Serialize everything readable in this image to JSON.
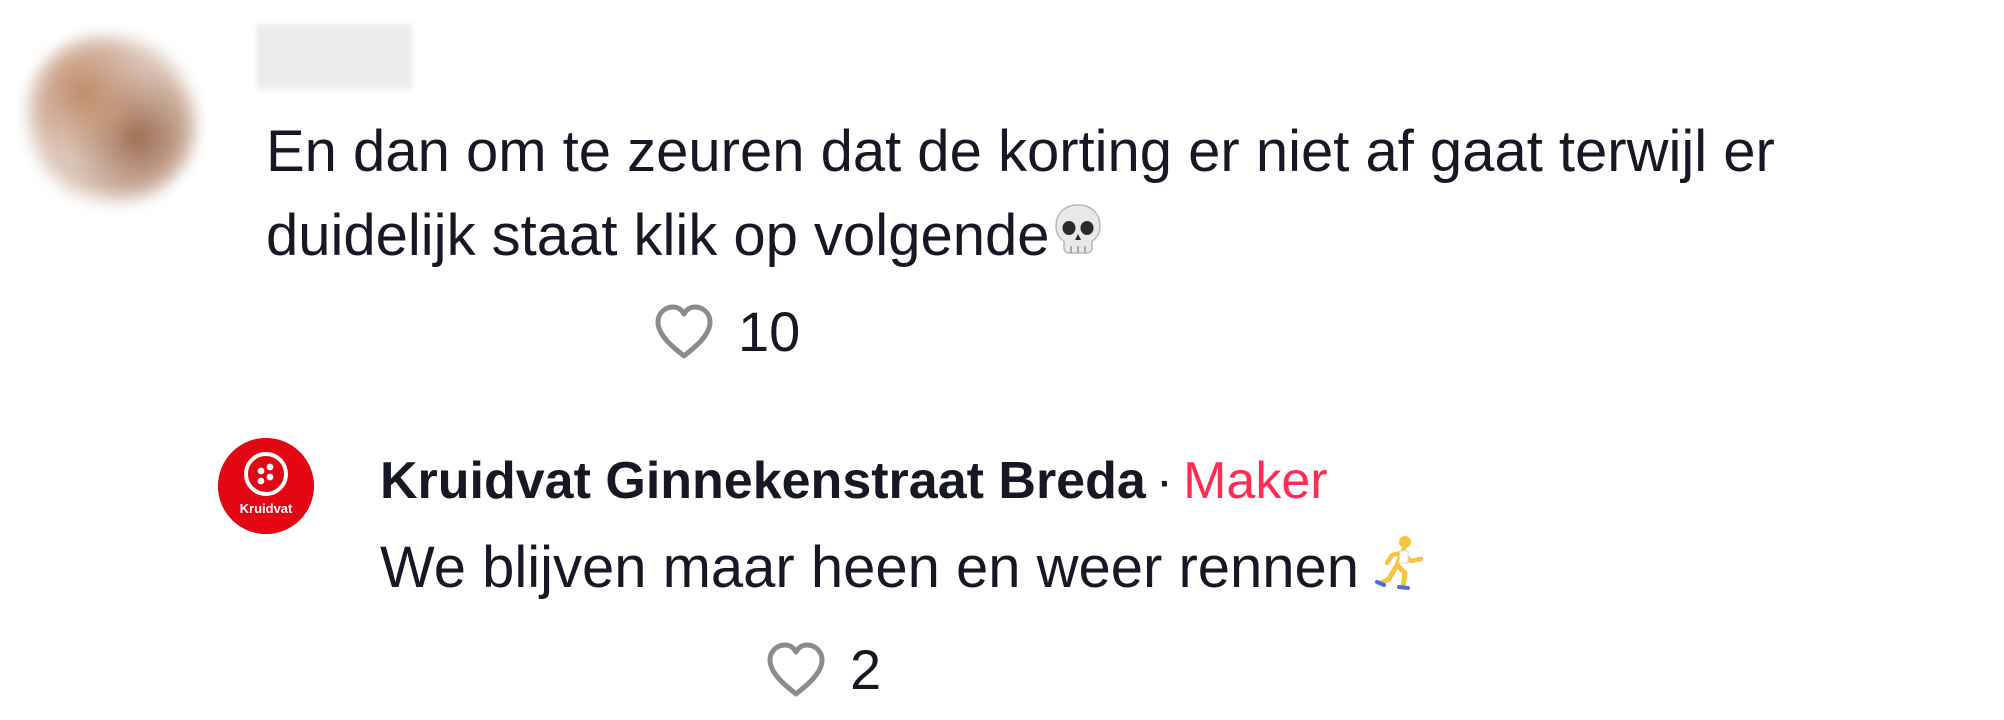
{
  "comment": {
    "username": "",
    "text_line_1": "En dan om te zeuren dat de korting er niet af gaat terwijl er",
    "text_line_2": "duidelijk staat klik op volgende",
    "emoji": "skull-emoji",
    "likes": "10"
  },
  "reply": {
    "author": "Kruidvat Ginnekenstraat Breda",
    "separator": "·",
    "badge": "Maker",
    "badge_color": "#fe2c55",
    "text": "We blijven maar heen en weer rennen",
    "emoji": "running-man-emoji",
    "likes": "2",
    "avatar_label": "Kruidvat",
    "avatar_color": "#e30613"
  }
}
